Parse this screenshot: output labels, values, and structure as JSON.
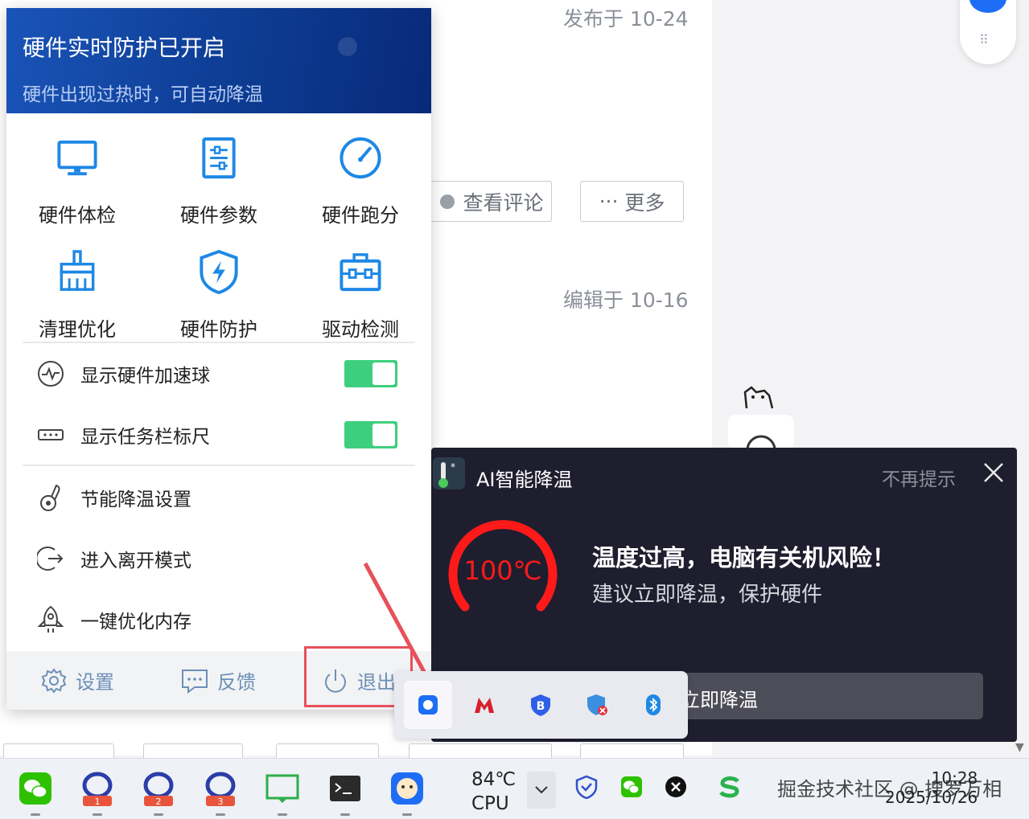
{
  "background": {
    "published": "发布于 10-24",
    "edited": "编辑于 10-16",
    "view_comments": "查看评论",
    "more": "更多",
    "more_dots": "···"
  },
  "panel": {
    "title": "硬件实时防护已开启",
    "subtitle": "硬件出现过热时，可自动降温",
    "grid": [
      {
        "label": "硬件体检",
        "icon": "monitor-icon"
      },
      {
        "label": "硬件参数",
        "icon": "parameters-icon"
      },
      {
        "label": "硬件跑分",
        "icon": "speedometer-icon"
      },
      {
        "label": "清理优化",
        "icon": "broom-icon"
      },
      {
        "label": "硬件防护",
        "icon": "shield-bolt-icon"
      },
      {
        "label": "驱动检测",
        "icon": "toolbox-icon"
      }
    ],
    "toggles": [
      {
        "label": "显示硬件加速球",
        "on": true
      },
      {
        "label": "显示任务栏标尺",
        "on": true
      }
    ],
    "menu": [
      {
        "label": "节能降温设置"
      },
      {
        "label": "进入离开模式"
      },
      {
        "label": "一键优化内存"
      }
    ],
    "footer": {
      "settings": "设置",
      "feedback": "反馈",
      "exit": "退出"
    }
  },
  "notification": {
    "app_name": "AI智能降温",
    "dismiss": "不再提示",
    "temperature": "100℃",
    "title": "温度过高，电脑有关机风险！",
    "subtitle": "建议立即降温，保护硬件",
    "action": "立即降温"
  },
  "taskbar": {
    "badges": [
      "1",
      "2",
      "3"
    ],
    "cpu_temp": "84℃",
    "cpu_label": "CPU",
    "watermark": "掘金技术社区 @ 搜罗万相",
    "time": "10:28",
    "date": "2025/10/26"
  },
  "colors": {
    "accent_blue": "#1e88e5",
    "toggle_green": "#3ecf7e",
    "header_blue": "#0d3c93",
    "highlight_red": "#e8505b",
    "gauge_red": "#ff1a1a",
    "notification_bg": "#1e1e2f"
  }
}
